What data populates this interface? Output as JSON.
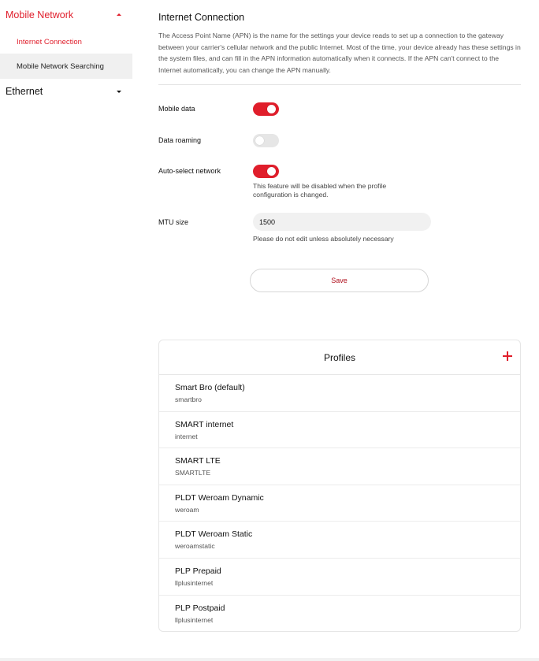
{
  "sidebar": {
    "groups": [
      {
        "label": "Mobile Network",
        "items": [
          {
            "label": "Internet Connection"
          },
          {
            "label": "Mobile Network Searching"
          }
        ]
      },
      {
        "label": "Ethernet"
      }
    ]
  },
  "main": {
    "title": "Internet Connection",
    "description": "The Access Point Name (APN) is the name for the settings your device reads to set up a connection to the gateway between your carrier's cellular network and the public Internet. Most of the time, your device already has these settings in the system files, and can fill in the APN information automatically when it connects. If the APN can't connect to the Internet automatically, you can change the APN manually.",
    "mobile_data": {
      "label": "Mobile data",
      "enabled": true
    },
    "data_roaming": {
      "label": "Data roaming",
      "enabled": false
    },
    "auto_select": {
      "label": "Auto-select network",
      "enabled": true,
      "hint": "This feature will be disabled when the profile configuration is changed."
    },
    "mtu": {
      "label": "MTU size",
      "value": "1500",
      "hint": "Please do not edit unless absolutely necessary"
    },
    "save_label": "Save"
  },
  "profiles": {
    "title": "Profiles",
    "items": [
      {
        "name": "Smart Bro (default)",
        "apn": "smartbro"
      },
      {
        "name": "SMART internet",
        "apn": "internet"
      },
      {
        "name": "SMART LTE",
        "apn": "SMARTLTE"
      },
      {
        "name": "PLDT Weroam Dynamic",
        "apn": "weroam"
      },
      {
        "name": "PLDT Weroam Static",
        "apn": "weroamstatic"
      },
      {
        "name": "PLP Prepaid",
        "apn": "llplusinternet"
      },
      {
        "name": "PLP Postpaid",
        "apn": "llplusinternet"
      }
    ]
  },
  "colors": {
    "accent": "#e01e2b",
    "toggle_off": "#e6e6e6",
    "input_bg": "#f1f1f1"
  }
}
